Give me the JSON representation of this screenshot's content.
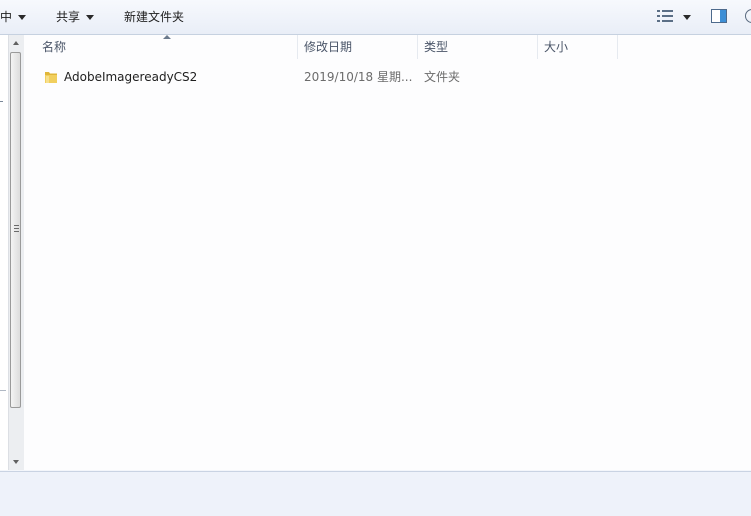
{
  "toolbar": {
    "include_label": "中",
    "share_label": "共享",
    "new_folder_label": "新建文件夹"
  },
  "columns": {
    "name": "名称",
    "date": "修改日期",
    "type": "类型",
    "size": "大小"
  },
  "files": [
    {
      "name": "AdobeImagereadyCS2",
      "date": "2019/10/18 星期...",
      "type": "文件夹",
      "size": ""
    }
  ],
  "icons": {
    "folder": "folder-icon",
    "view": "view-options-icon",
    "preview_pane": "preview-pane-icon",
    "help": "help-icon"
  },
  "colors": {
    "toolbar_top": "#f7f9fd",
    "folder_yellow": "#e8c24a"
  }
}
